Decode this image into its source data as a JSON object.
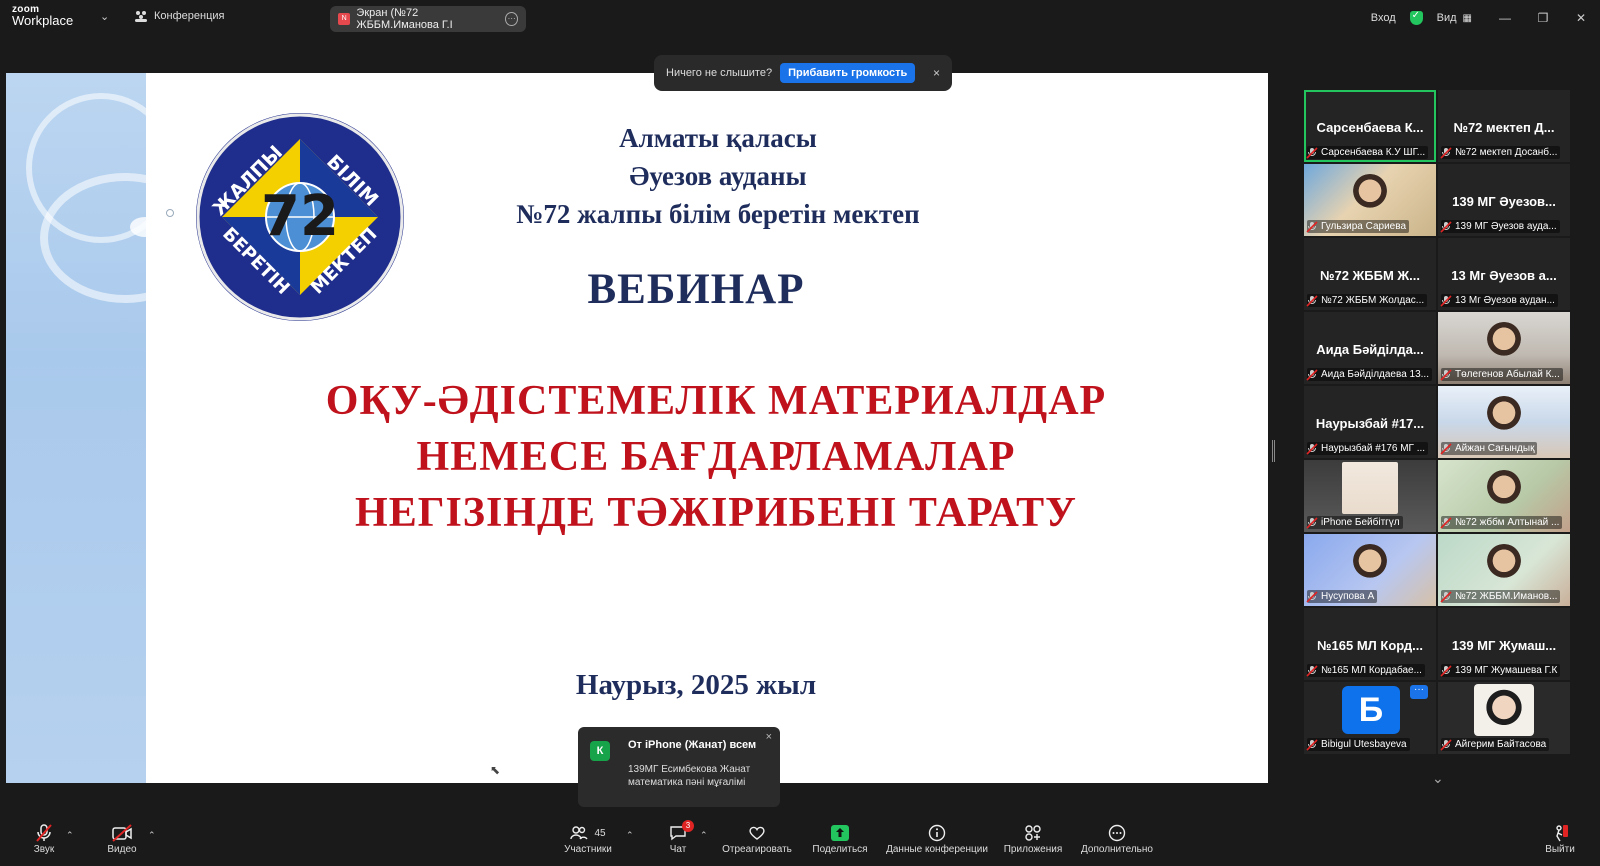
{
  "app": {
    "logo_line1": "zoom",
    "logo_line2": "Workplace",
    "conference_label": "Конференция",
    "screen_share_label": "Экран (№72 ЖББМ.Иманова Г.I",
    "sign_in": "Вход",
    "view_label": "Вид"
  },
  "notice": {
    "text": "Ничего не слышите?",
    "button": "Прибавить громкость",
    "close": "×"
  },
  "slide": {
    "line1": "Алматы қаласы",
    "line2": "Әуезов ауданы",
    "line3": "№72 жалпы білім беретін мектеп",
    "webinar": "ВЕБИНАР",
    "red1": "ОҚУ-ӘДІСТЕМЕЛІК МАТЕРИАЛДАР",
    "red2": "НЕМЕСЕ БАҒДАРЛАМАЛАР",
    "red3": "НЕГІЗІНДЕ ТӘЖІРИБЕНІ ТАРАТУ",
    "date": "Наурыз, 2025 жыл",
    "emblem_number": "72",
    "emblem_top_left": "ЖАЛПЫ",
    "emblem_top_right": "БІЛІМ",
    "emblem_bottom_left": "БЕРЕТІН",
    "emblem_bottom_right": "МЕКТЕП"
  },
  "chat_popup": {
    "avatar_letter": "К",
    "title": "От iPhone (Жанат) всем",
    "body_line1": "139МГ Есимбекова Жанат",
    "body_line2": "математика пәні мұғалімі",
    "close": "×"
  },
  "gallery": [
    {
      "name": "Сарсенбаева К...",
      "label": "Сарсенбаева К.У ШГ...",
      "kind": "name",
      "active": true
    },
    {
      "name": "№72 мектеп Д...",
      "label": "№72 мектеп Досанб...",
      "kind": "name"
    },
    {
      "name": "",
      "label": "Гульзира Сариева",
      "kind": "video1"
    },
    {
      "name": "139 МГ Әуезов...",
      "label": "139 МГ Әуезов ауда...",
      "kind": "name"
    },
    {
      "name": "№72 ЖББМ Ж...",
      "label": "№72 ЖББМ Жолдас...",
      "kind": "name"
    },
    {
      "name": "13 Мг Әуезов а...",
      "label": "13 Мг Әуезов аудан...",
      "kind": "name"
    },
    {
      "name": "Аида Бәйділда...",
      "label": "Аида Бәйділдаева 13...",
      "kind": "name"
    },
    {
      "name": "",
      "label": "Төлегенов Абылай К...",
      "kind": "video2"
    },
    {
      "name": "Наурызбай #17...",
      "label": "Наурызбай #176 МГ ...",
      "kind": "name"
    },
    {
      "name": "",
      "label": "Айжан Сағындық",
      "kind": "video3"
    },
    {
      "name": "",
      "label": "iPhone Бейбітгүл",
      "kind": "video4"
    },
    {
      "name": "",
      "label": "№72 жббм Алтынай ...",
      "kind": "video5"
    },
    {
      "name": "",
      "label": "Нусупова А",
      "kind": "video6"
    },
    {
      "name": "",
      "label": "№72 ЖББМ.Иманов...",
      "kind": "video7"
    },
    {
      "name": "№165 МЛ Корд...",
      "label": "№165 МЛ Кордабае...",
      "kind": "name"
    },
    {
      "name": "139 МГ Жумаш...",
      "label": "139 МГ Жумашева Г.К",
      "kind": "name"
    },
    {
      "name": "Б",
      "label": "Bibigul Utesbayeva",
      "kind": "avatar"
    },
    {
      "name": "",
      "label": "Айгерим Байтасова",
      "kind": "video8"
    }
  ],
  "toolbar": {
    "audio": "Звук",
    "video": "Видео",
    "participants": "Участники",
    "participants_count": "45",
    "chat": "Чат",
    "chat_badge": "3",
    "react": "Отреагировать",
    "share": "Поделиться",
    "info": "Данные конференции",
    "apps": "Приложения",
    "more": "Дополнительно",
    "leave": "Выйти"
  },
  "colors": {
    "accent_blue": "#1a73e8",
    "share_green": "#22c55e",
    "slide_navy": "#1f2d5c",
    "slide_red": "#c0121c",
    "mute_red": "#e02424"
  }
}
